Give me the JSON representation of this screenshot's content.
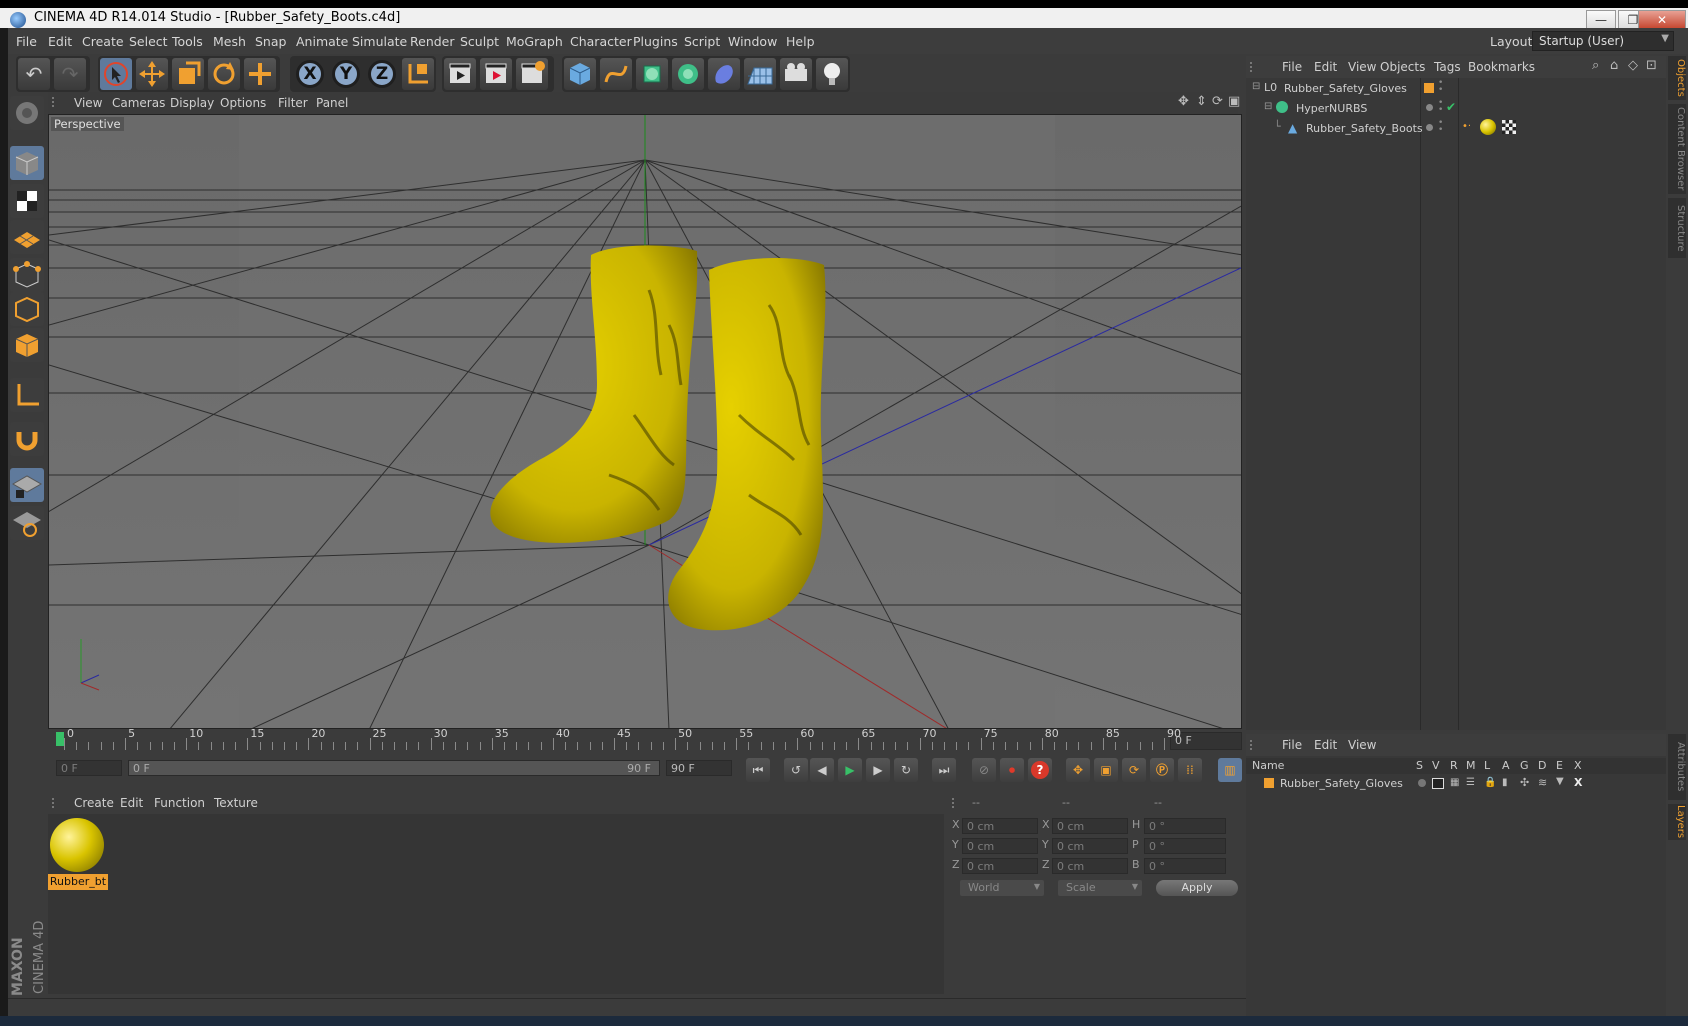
{
  "window": {
    "title": "CINEMA 4D R14.014 Studio - [Rubber_Safety_Boots.c4d]",
    "minimize": "—",
    "restore": "❐",
    "close": "✕"
  },
  "menubar": {
    "items": [
      "File",
      "Edit",
      "Create",
      "Select",
      "Tools",
      "Mesh",
      "Snap",
      "Animate",
      "Simulate",
      "Render",
      "Sculpt",
      "MoGraph",
      "Character",
      "Plugins",
      "Script",
      "Window",
      "Help"
    ],
    "layout_label": "Layout:",
    "layout_value": "Startup (User)"
  },
  "toolbar": {
    "axis_x": "X",
    "axis_y": "Y",
    "axis_z": "Z"
  },
  "viewport": {
    "menu": [
      "View",
      "Cameras",
      "Display",
      "Options",
      "Filter",
      "Panel"
    ],
    "label": "Perspective",
    "colors": {
      "yellow": "#d9c400",
      "grid": "#2a2a2a",
      "bg": "#6e6e6e"
    }
  },
  "timeline": {
    "ticks": [
      "0",
      "5",
      "10",
      "15",
      "20",
      "25",
      "30",
      "35",
      "40",
      "45",
      "50",
      "55",
      "60",
      "65",
      "70",
      "75",
      "80",
      "85",
      "90"
    ],
    "current_frame": "0 F",
    "start_field": "0 F",
    "slider_start": "0 F",
    "slider_end": "90 F",
    "end_field": "90 F"
  },
  "material_panel": {
    "menu": [
      "Create",
      "Edit",
      "Function",
      "Texture"
    ],
    "material_name": "Rubber_bt"
  },
  "coords_panel": {
    "headers": [
      "--",
      "--",
      "--"
    ],
    "rows": [
      {
        "a_label": "X",
        "a_val": "0 cm",
        "b_label": "X",
        "b_val": "0 cm",
        "c_label": "H",
        "c_val": "0 °"
      },
      {
        "a_label": "Y",
        "a_val": "0 cm",
        "b_label": "Y",
        "b_val": "0 cm",
        "c_label": "P",
        "c_val": "0 °"
      },
      {
        "a_label": "Z",
        "a_val": "0 cm",
        "b_label": "Z",
        "b_val": "0 cm",
        "c_label": "B",
        "c_val": "0 °"
      }
    ],
    "world": "World",
    "scale": "Scale",
    "apply": "Apply"
  },
  "objects_panel": {
    "menu": [
      "File",
      "Edit",
      "View",
      "Objects",
      "Tags",
      "Bookmarks"
    ],
    "items": [
      {
        "name": "Rubber_Safety_Gloves"
      },
      {
        "name": "HyperNURBS"
      },
      {
        "name": "Rubber_Safety_Boots"
      }
    ]
  },
  "layers_panel": {
    "menu": [
      "File",
      "Edit",
      "View"
    ],
    "columns": [
      "Name",
      "S",
      "V",
      "R",
      "M",
      "L",
      "A",
      "G",
      "D",
      "E",
      "X"
    ],
    "row_name": "Rubber_Safety_Gloves"
  },
  "side_tabs": [
    "Objects",
    "Content Browser",
    "Structure",
    "Attributes",
    "Layers"
  ],
  "branding": {
    "maxon": "MAXON",
    "product": "CINEMA 4D"
  }
}
